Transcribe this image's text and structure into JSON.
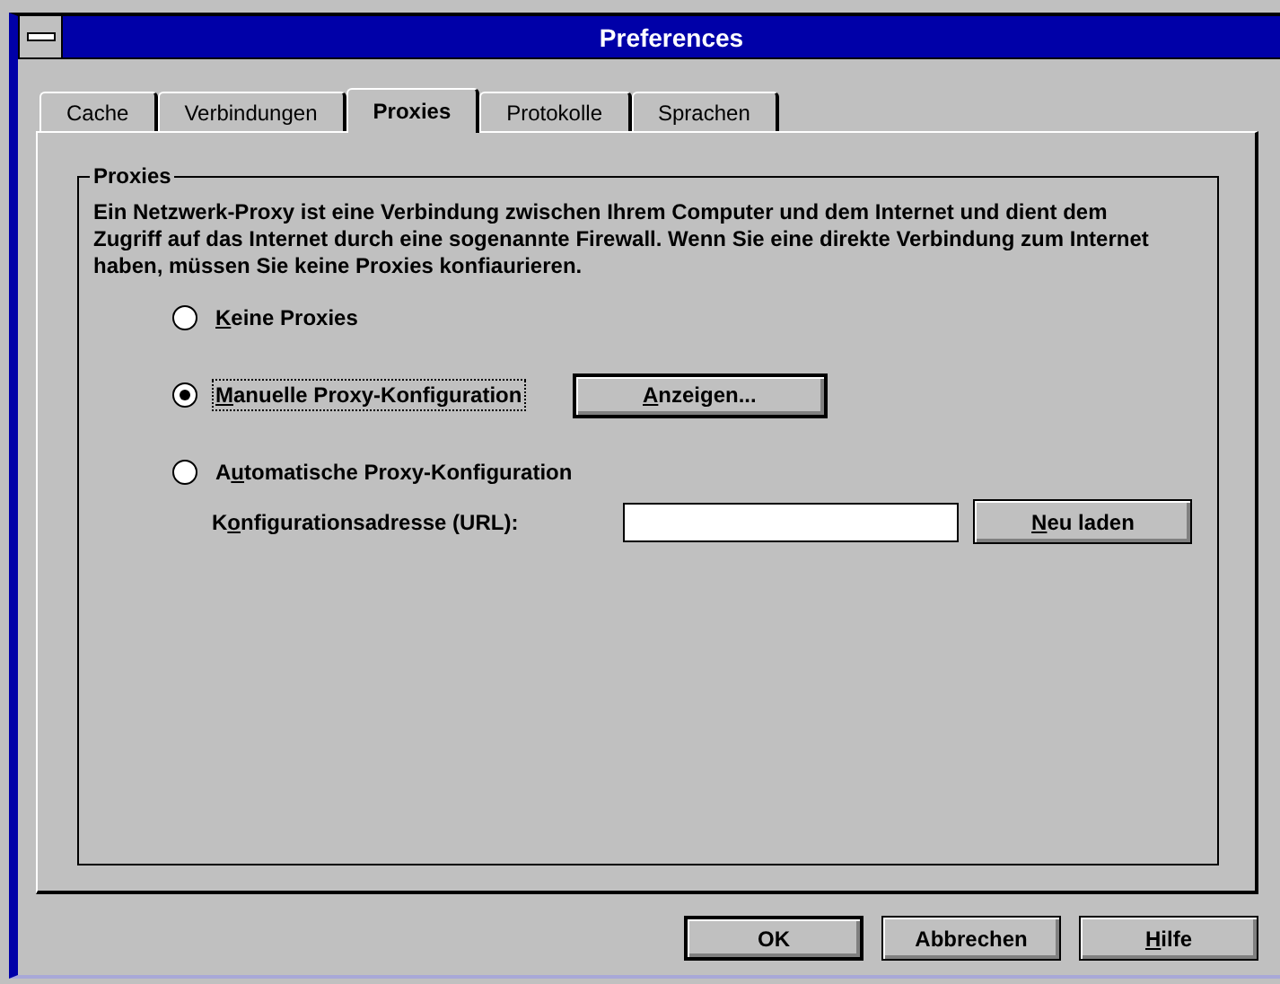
{
  "window": {
    "title": "Preferences"
  },
  "tabs": [
    {
      "label": "Cache",
      "selected": false
    },
    {
      "label": "Verbindungen",
      "selected": false
    },
    {
      "label": "Proxies",
      "selected": true
    },
    {
      "label": "Protokolle",
      "selected": false
    },
    {
      "label": "Sprachen",
      "selected": false
    }
  ],
  "group": {
    "title": "Proxies",
    "description": "Ein Netzwerk-Proxy ist eine Verbindung zwischen Ihrem Computer und dem Internet und dient dem Zugriff auf das Internet durch eine sogenannte Firewall. Wenn Sie eine direkte Verbindung zum Internet haben, müssen Sie keine Proxies konfiaurieren."
  },
  "options": [
    {
      "key": "K",
      "after": "eine Proxies",
      "selected": false,
      "focused": false
    },
    {
      "key": "M",
      "after": "anuelle Proxy-Konfiguration",
      "selected": true,
      "focused": true,
      "button": {
        "key": "A",
        "after": "nzeigen..."
      }
    },
    {
      "before": "A",
      "key": "u",
      "after": "tomatische Proxy-Konfiguration",
      "selected": false,
      "focused": false
    }
  ],
  "url": {
    "label": {
      "before": "K",
      "key": "o",
      "after": "nfigurationsadresse (URL):"
    },
    "button": {
      "key": "N",
      "after": "eu laden"
    }
  },
  "buttons": [
    {
      "label": {
        "after": "OK"
      },
      "default": true
    },
    {
      "label": {
        "after": "Abbrechen"
      },
      "default": false
    },
    {
      "label": {
        "key": "H",
        "after": "ilfe"
      },
      "default": false
    }
  ]
}
